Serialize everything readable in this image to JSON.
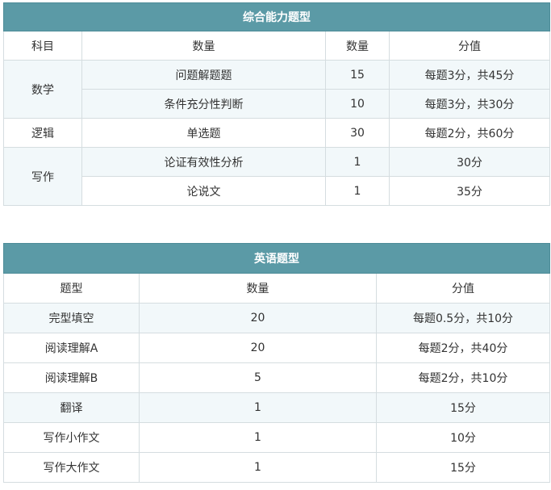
{
  "table1": {
    "title": "综合能力题型",
    "headers": [
      "科目",
      "数量",
      "数量",
      "分值"
    ],
    "math_label": "数学",
    "logic_label": "逻辑",
    "writing_label": "写作",
    "rows": [
      {
        "item": "问题解题题",
        "count": "15",
        "score": "每题3分，共45分"
      },
      {
        "item": "条件充分性判断",
        "count": "10",
        "score": "每题3分，共30分"
      },
      {
        "item": "单选题",
        "count": "30",
        "score": "每题2分，共60分"
      },
      {
        "item": "论证有效性分析",
        "count": "1",
        "score": "30分"
      },
      {
        "item": "论说文",
        "count": "1",
        "score": "35分"
      }
    ]
  },
  "table2": {
    "title": "英语题型",
    "headers": [
      "题型",
      "数量",
      "分值"
    ],
    "rows": [
      {
        "type": "完型填空",
        "count": "20",
        "score": "每题0.5分，共10分"
      },
      {
        "type": "阅读理解A",
        "count": "20",
        "score": "每题2分，共40分"
      },
      {
        "type": "阅读理解B",
        "count": "5",
        "score": "每题2分，共10分"
      },
      {
        "type": "翻译",
        "count": "1",
        "score": "15分"
      },
      {
        "type": "写作小作文",
        "count": "1",
        "score": "10分"
      },
      {
        "type": "写作大作文",
        "count": "1",
        "score": "15分"
      }
    ]
  }
}
